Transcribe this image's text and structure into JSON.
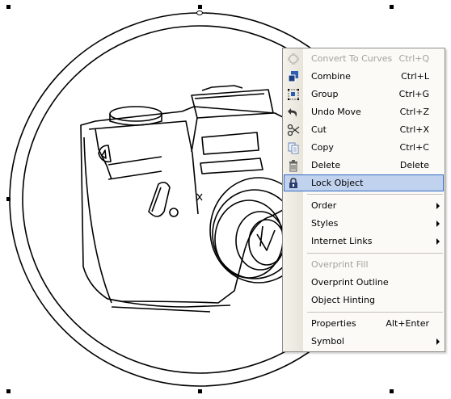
{
  "context_menu": {
    "items": [
      {
        "label": "Convert To Curves",
        "shortcut": "Ctrl+Q",
        "disabled": true,
        "icon": "convert-curves-icon"
      },
      {
        "label": "Combine",
        "shortcut": "Ctrl+L",
        "icon": "combine-icon"
      },
      {
        "label": "Group",
        "shortcut": "Ctrl+G",
        "icon": "group-icon"
      },
      {
        "label": "Undo Move",
        "shortcut": "Ctrl+Z",
        "icon": "undo-icon"
      },
      {
        "label": "Cut",
        "shortcut": "Ctrl+X",
        "icon": "scissors-icon"
      },
      {
        "label": "Copy",
        "shortcut": "Ctrl+C",
        "icon": "copy-icon"
      },
      {
        "label": "Delete",
        "shortcut": "Delete",
        "icon": "trash-icon"
      },
      {
        "label": "Lock Object",
        "shortcut": "",
        "icon": "lock-icon",
        "highlighted": true
      },
      {
        "label": "Order",
        "submenu": true
      },
      {
        "label": "Styles",
        "submenu": true
      },
      {
        "label": "Internet Links",
        "submenu": true
      },
      {
        "label": "Overprint Fill",
        "disabled": true
      },
      {
        "label": "Overprint Outline"
      },
      {
        "label": "Object Hinting"
      },
      {
        "label": "Properties",
        "shortcut": "Alt+Enter"
      },
      {
        "label": "Symbol",
        "submenu": true
      }
    ]
  },
  "colors": {
    "highlight_bg": "#c1d2ee",
    "highlight_border": "#316ac5",
    "disabled_text": "#a3a29a",
    "menu_bg": "#fbfaf6"
  }
}
